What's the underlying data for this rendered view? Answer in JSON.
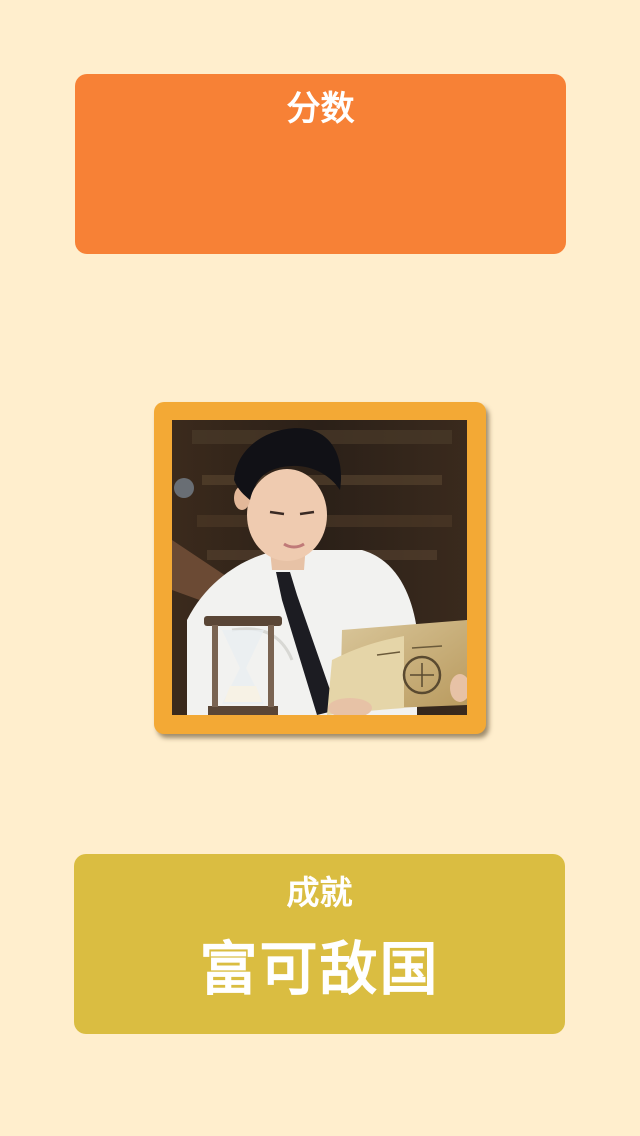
{
  "score": {
    "title": "分数",
    "value": ""
  },
  "photo": {
    "description_icon": "portrait-photo"
  },
  "achievement": {
    "title": "成就",
    "value": "富可敌国"
  },
  "colors": {
    "background": "#ffeecd",
    "score_card": "#f78136",
    "photo_frame": "#f3a935",
    "achievement_card": "#dabd41",
    "text": "#ffffff"
  }
}
